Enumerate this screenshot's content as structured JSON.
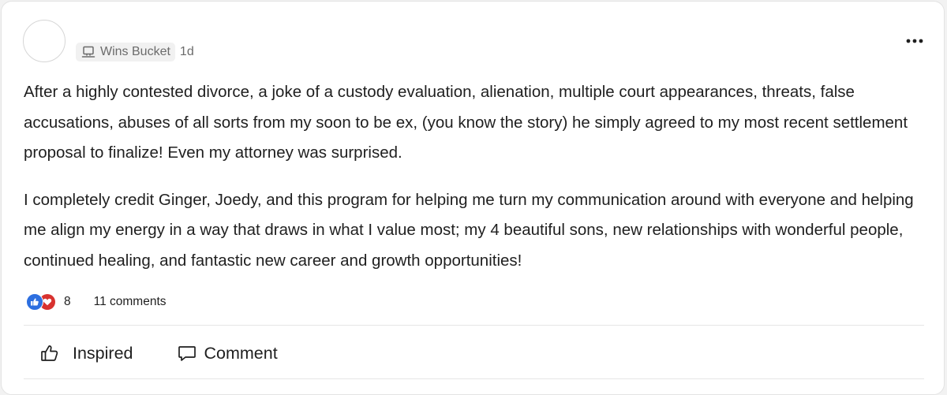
{
  "post": {
    "space_name": "Wins Bucket",
    "space_icon": "laptop-icon",
    "time_ago": "1d",
    "paragraphs": [
      "After a highly contested divorce, a joke of a custody evaluation, alienation, multiple court appearances, threats, false accusations, abuses of all sorts from my soon to be ex, (you know the story) he simply agreed to my most recent settlement proposal to finalize! Even my attorney was surprised.",
      "I completely credit Ginger, Joedy, and this program for helping me turn my communication around with everyone and helping me align my energy in a way that draws in what I value most; my 4 beautiful sons, new relationships with wonderful people, continued healing, and fantastic new career and growth opportunities!"
    ]
  },
  "stats": {
    "reaction_count": "8",
    "comments_label": "11 comments",
    "reaction_colors": {
      "like": "#2d6fe0",
      "other": "#d8322f"
    }
  },
  "actions": {
    "inspired_label": "Inspired",
    "comment_label": "Comment"
  }
}
